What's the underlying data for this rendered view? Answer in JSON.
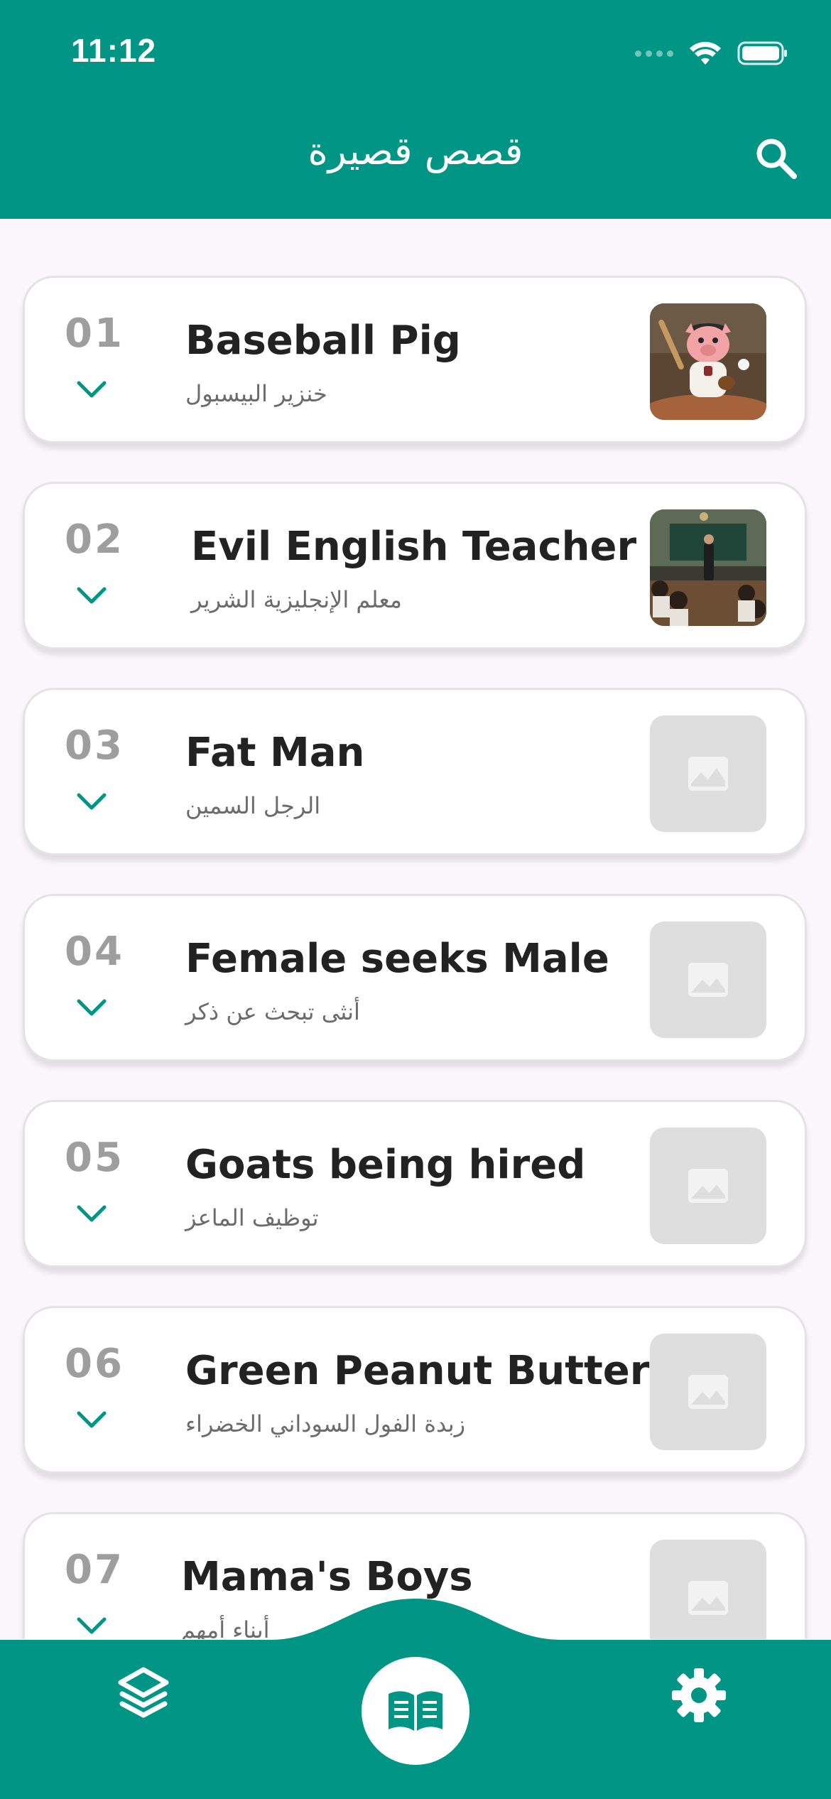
{
  "status_bar": {
    "time": "11:12"
  },
  "header": {
    "title": "قصص قصيرة",
    "search_icon": "search-icon"
  },
  "colors": {
    "primary": "#009585",
    "card_background": "#ffffff",
    "page_background": "#fbf6fc",
    "number": "#9e9e9e",
    "title": "#222222",
    "subtitle": "#6b6b6b",
    "placeholder": "#dedede"
  },
  "stories": [
    {
      "number": "01",
      "title": "Baseball Pig",
      "subtitle": "خنزير البيسبول",
      "thumbnail": "baseball-pig-image"
    },
    {
      "number": "02",
      "title": "Evil English Teacher",
      "subtitle": "معلم الإنجليزية الشرير",
      "thumbnail": "classroom-teacher-image"
    },
    {
      "number": "03",
      "title": "Fat Man",
      "subtitle": "الرجل السمين",
      "thumbnail": "placeholder-image-icon"
    },
    {
      "number": "04",
      "title": "Female seeks Male",
      "subtitle": "أنثى تبحث عن ذكر",
      "thumbnail": "placeholder-image-icon"
    },
    {
      "number": "05",
      "title": "Goats being hired",
      "subtitle": "توظيف الماعز",
      "thumbnail": "placeholder-image-icon"
    },
    {
      "number": "06",
      "title": "Green Peanut Butter",
      "subtitle": "زبدة الفول السوداني الخضراء",
      "thumbnail": "placeholder-image-icon"
    },
    {
      "number": "07",
      "title": "Mama's Boys",
      "subtitle": "أبناء أمهم",
      "thumbnail": "placeholder-image-icon"
    }
  ],
  "bottom_nav": {
    "items": [
      {
        "icon": "layers-icon"
      },
      {
        "icon": "open-book-icon"
      },
      {
        "icon": "gear-icon"
      }
    ]
  }
}
